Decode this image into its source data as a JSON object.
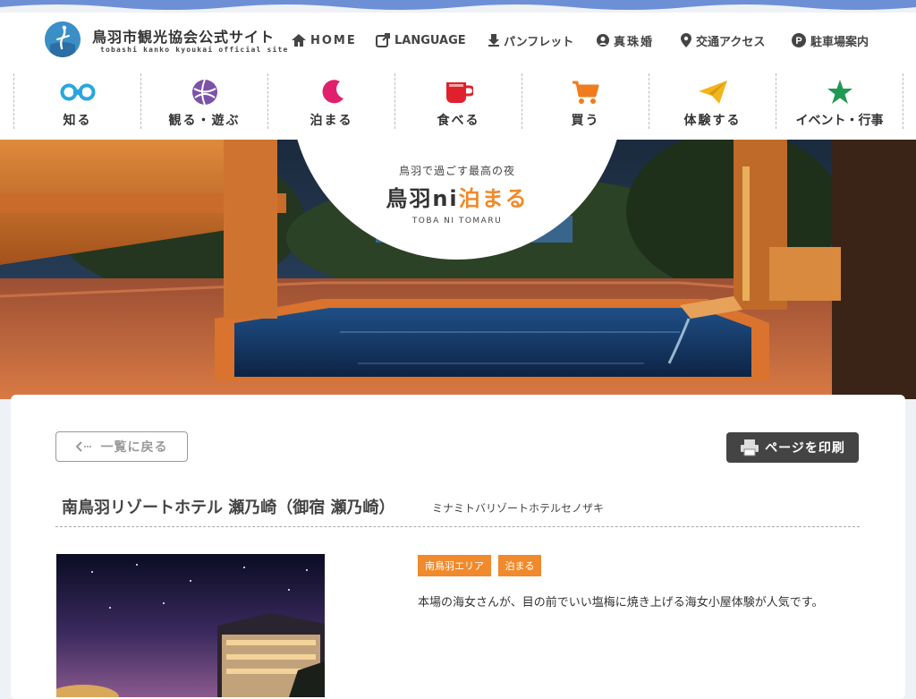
{
  "site": {
    "title": "鳥羽市観光協会公式サイト",
    "subtitle": "tobashi kanko kyoukai official site"
  },
  "top_nav": [
    {
      "label": "HOME",
      "icon": "home-icon"
    },
    {
      "label": "LANGUAGE",
      "icon": "external-link-icon"
    },
    {
      "label": "パンフレット",
      "icon": "download-icon"
    },
    {
      "label": "真珠婚",
      "icon": "person-icon"
    },
    {
      "label": "交通アクセス",
      "icon": "map-pin-icon"
    },
    {
      "label": "駐車場案内",
      "icon": "parking-icon"
    }
  ],
  "main_nav": [
    {
      "label": "知る",
      "icon": "binoculars-icon",
      "color": "#29a6df"
    },
    {
      "label": "観る・遊ぶ",
      "icon": "ball-icon",
      "color": "#7b52a8"
    },
    {
      "label": "泊まる",
      "icon": "moon-icon",
      "color": "#e0206c"
    },
    {
      "label": "食べる",
      "icon": "cup-icon",
      "color": "#e0202c"
    },
    {
      "label": "買う",
      "icon": "cart-icon",
      "color": "#f07c1e"
    },
    {
      "label": "体験する",
      "icon": "paper-plane-icon",
      "color": "#f2b51e"
    },
    {
      "label": "イベント・行事",
      "icon": "star-icon",
      "color": "#1f9a54"
    }
  ],
  "hero": {
    "small": "鳥羽で過ごす最高の夜",
    "title_prefix": "鳥羽ni",
    "title_highlight": "泊まる",
    "english": "TOBA NI TOMARU"
  },
  "detail": {
    "back_label": "一覧に戻る",
    "print_label": "ページを印刷",
    "name": "南鳥羽リゾートホテル 瀬乃崎（御宿 瀬乃崎）",
    "kana": "ミナミトバリゾートホテルセノザキ",
    "tags": [
      "南鳥羽エリア",
      "泊まる"
    ],
    "description": "本場の海女さんが、目の前でいい塩梅に焼き上げる海女小屋体験が人気です。"
  },
  "colors": {
    "accent": "#f08a2c",
    "brand_blue": "#3a8fc7",
    "top_wave": "#6c8fd6"
  }
}
